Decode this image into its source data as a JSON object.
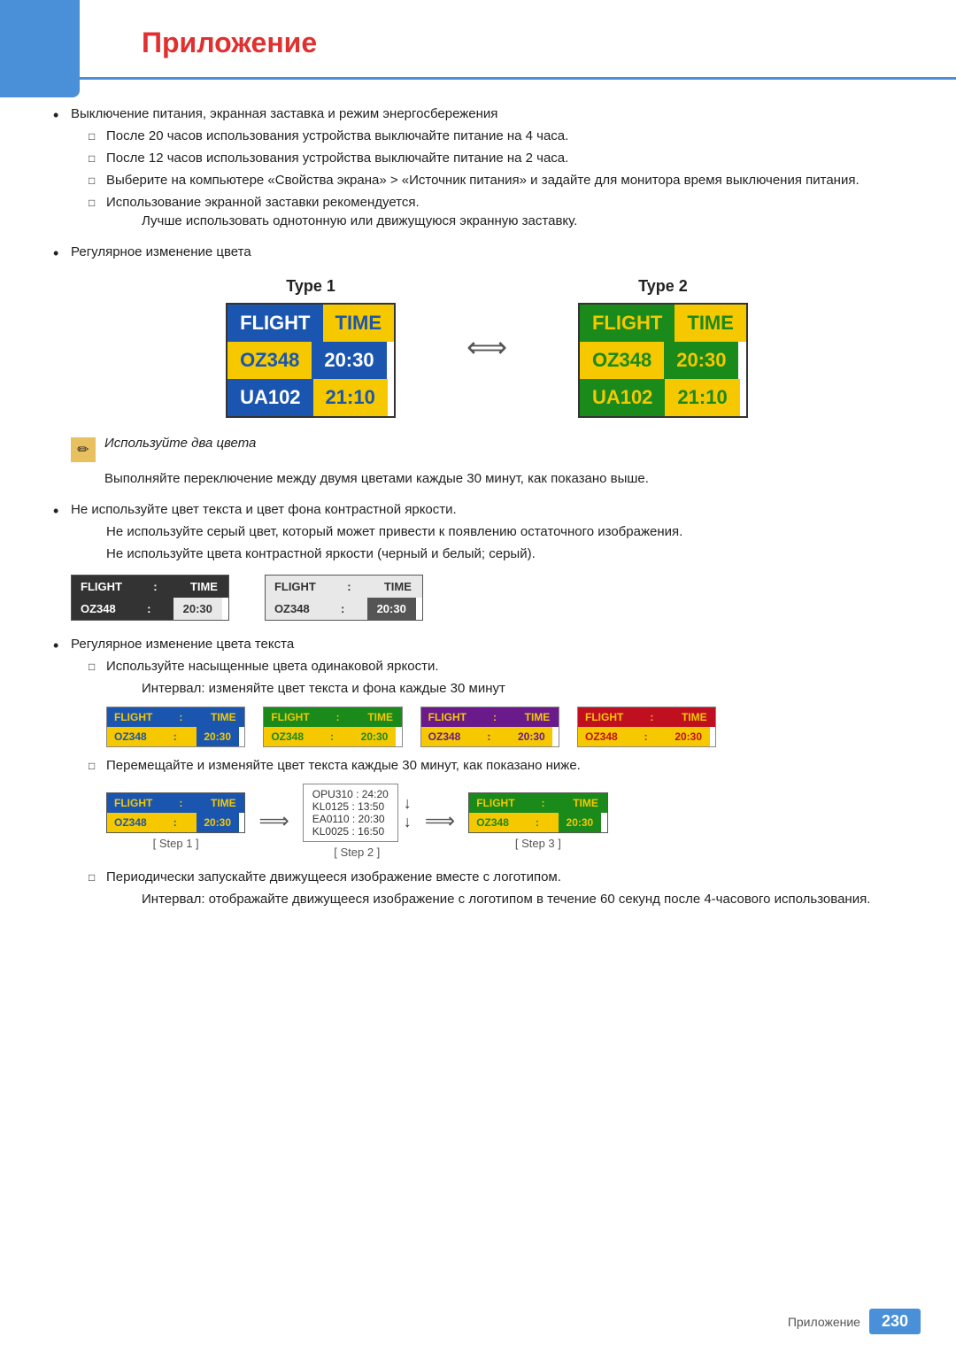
{
  "page": {
    "title": "Приложение",
    "footer_label": "Приложение",
    "footer_number": "230"
  },
  "content": {
    "bullet1": "Выключение питания, экранная заставка и режим энергосбережения",
    "sub1_1": "После 20 часов использования устройства выключайте питание на 4 часа.",
    "sub1_2": "После 12 часов использования устройства выключайте питание на 2 часа.",
    "sub1_3": "Выберите на компьютере «Свойства экрана» > «Источник питания» и задайте для монитора время выключения питания.",
    "sub1_4": "Использование экранной заставки рекомендуется.",
    "sub1_4b": "Лучше использовать однотонную или движущуюся экранную заставку.",
    "bullet2": "Регулярное изменение цвета",
    "type1_label": "Type 1",
    "type2_label": "Type 2",
    "board_flight": "FLIGHT",
    "board_time": "TIME",
    "board_oz": "OZ348",
    "board_2030": "20:30",
    "board_ua": "UA102",
    "board_2110": "21:10",
    "note_text": "Используйте два цвета",
    "note_detail": "Выполняйте переключение между двумя цветами каждые 30 минут, как показано выше.",
    "bullet3": "Не используйте цвет текста и цвет фона контрастной яркости.",
    "sub3_1": "Не используйте серый цвет, который может привести к появлению остаточного изображения.",
    "sub3_2": "Не используйте цвета контрастной яркости (черный и белый; серый).",
    "bullet4": "Регулярное изменение цвета текста",
    "sub4_1": "Используйте насыщенные цвета одинаковой яркости.",
    "sub4_1b": "Интервал: изменяйте цвет текста и фона каждые 30 минут",
    "sub4_2": "Перемещайте и изменяйте цвет текста каждые 30 минут, как показано ниже.",
    "step1_label": "[ Step 1 ]",
    "step2_label": "[ Step 2 ]",
    "step3_label": "[ Step 3 ]",
    "sub4_3": "Периодически запускайте движущееся изображение вместе с логотипом.",
    "sub4_3b": "Интервал: отображайте движущееся изображение с логотипом в течение 60 секунд после 4-часового использования.",
    "step2_lines": [
      "OPU310 : 24:20",
      "KL0125 : 13:50",
      "EA0110 : 20:30",
      "KL0025 : 16:50"
    ]
  }
}
